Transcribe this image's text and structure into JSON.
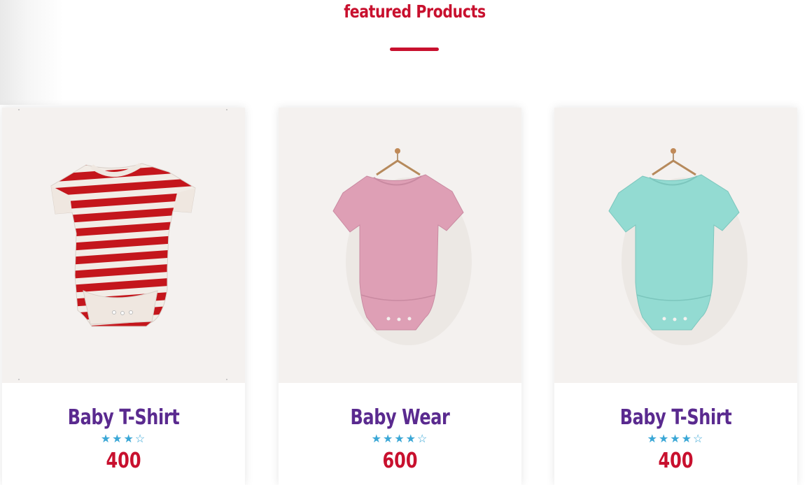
{
  "section": {
    "title": "featured Products",
    "accent_color": "#c8102e"
  },
  "products": [
    {
      "name": "Baby T-Shirt",
      "stars": "★★★☆",
      "rating": 3,
      "price": "400",
      "image": "red-white-striped-baby-bodysuit",
      "colors": {
        "main": "#c4161c",
        "alt": "#f2ece6"
      }
    },
    {
      "name": "Baby Wear",
      "stars": "★★★★☆",
      "rating": 4,
      "price": "600",
      "image": "pink-baby-bodysuit-on-hanger",
      "colors": {
        "main": "#de9fb5"
      }
    },
    {
      "name": "Baby T-Shirt",
      "stars": "★★★★☆",
      "rating": 4,
      "price": "400",
      "image": "mint-baby-bodysuit-on-hanger",
      "colors": {
        "main": "#93dbd2"
      }
    }
  ]
}
